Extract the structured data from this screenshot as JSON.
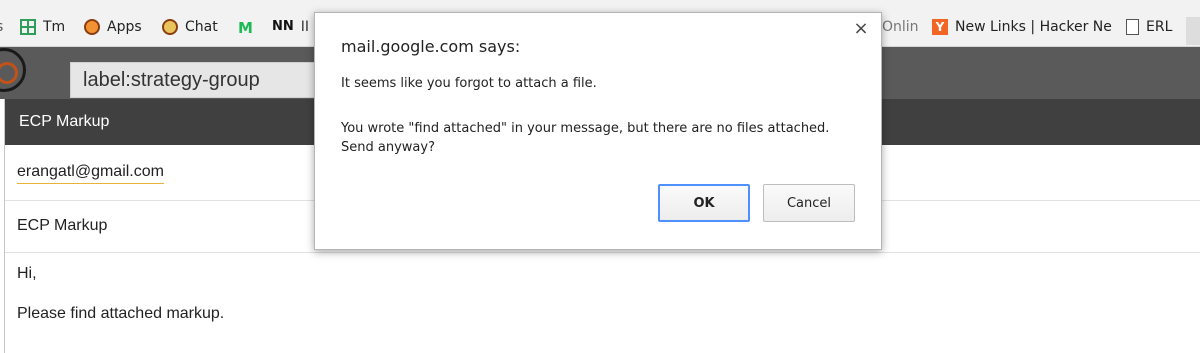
{
  "bookmarks": [
    {
      "label": "Tm",
      "icon": "sheets-icon"
    },
    {
      "label": "Apps",
      "icon": "apps-icon"
    },
    {
      "label": "Chat",
      "icon": "chat-icon"
    },
    {
      "label": "",
      "icon": "medium-icon"
    },
    {
      "label": "II",
      "icon": "nn-icon"
    },
    {
      "label": "Onlin",
      "icon": ""
    },
    {
      "label": "New Links | Hacker Ne",
      "icon": "hacker-news-icon"
    },
    {
      "label": "ERL",
      "icon": "document-icon"
    }
  ],
  "search": {
    "value": "label:strategy-group"
  },
  "compose": {
    "title": "ECP Markup",
    "to": "erangatl@gmail.com",
    "subject": "ECP Markup",
    "body": [
      "Hi,",
      "Please find attached markup."
    ]
  },
  "dialog": {
    "title": "mail.google.com says:",
    "line1": "It seems like you forgot to attach a file.",
    "line2": "You wrote \"find attached\" in your message, but there are no files attached. Send anyway?",
    "ok_label": "OK",
    "cancel_label": "Cancel",
    "close_symbol": "×"
  },
  "colors": {
    "header": "#5a5a5a",
    "compose_title": "#404040",
    "focus_blue": "#4d90fe"
  }
}
